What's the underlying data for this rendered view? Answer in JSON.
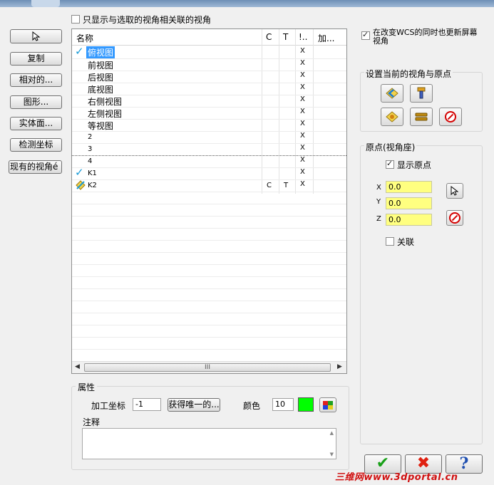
{
  "toolbar": {
    "filter_label": "只显示与选取的视角相关联的视角",
    "pick_icon": "cursor-icon",
    "copy": "复制",
    "relative": "相对的...",
    "graphic": "图形...",
    "solid_face": "实体面...",
    "check_coords": "检测坐标",
    "existing_views": "现有的视角é"
  },
  "views_list": {
    "columns": [
      "名称",
      "C",
      "T",
      "!..",
      "加..."
    ],
    "rows": [
      {
        "name": "俯视图",
        "c": "",
        "t": "",
        "x": "X"
      },
      {
        "name": "前视图",
        "c": "",
        "t": "",
        "x": "X"
      },
      {
        "name": "后视图",
        "c": "",
        "t": "",
        "x": "X"
      },
      {
        "name": "底视图",
        "c": "",
        "t": "",
        "x": "X"
      },
      {
        "name": "右侧视图",
        "c": "",
        "t": "",
        "x": "X"
      },
      {
        "name": "左侧视图",
        "c": "",
        "t": "",
        "x": "X"
      },
      {
        "name": "等视图",
        "c": "",
        "t": "",
        "x": "X"
      },
      {
        "name": "2",
        "c": "",
        "t": "",
        "x": "X"
      },
      {
        "name": "3",
        "c": "",
        "t": "",
        "x": "X"
      },
      {
        "name": "4",
        "c": "",
        "t": "",
        "x": "X"
      },
      {
        "name": "K1",
        "c": "",
        "t": "",
        "x": "X"
      },
      {
        "name": "K2",
        "c": "C",
        "t": "T",
        "x": "X"
      }
    ],
    "scroll_grip": "III"
  },
  "properties": {
    "title": "属性",
    "work_coord_label": "加工坐标",
    "work_coord_value": "-1",
    "unique_button": "获得唯一的...",
    "color_label": "颜色",
    "color_value": "10",
    "color_swatch": "#00ff00",
    "notes_label": "注释"
  },
  "right": {
    "update_screen_label_1": "在改变WCS的同时也更新屏幕",
    "update_screen_label_2": "视角",
    "set_view_title": "设置当前的视角与原点",
    "origin_title": "原点(视角座)",
    "show_origin": "显示原点",
    "x_label": "X",
    "y_label": "Y",
    "z_label": "Z",
    "x_value": "0.0",
    "y_value": "0.0",
    "z_value": "0.0",
    "associate": "关联"
  },
  "footer": {
    "ok": "✔",
    "cancel": "✖",
    "help": "?",
    "watermark": "三维网www.3dportal.cn"
  }
}
